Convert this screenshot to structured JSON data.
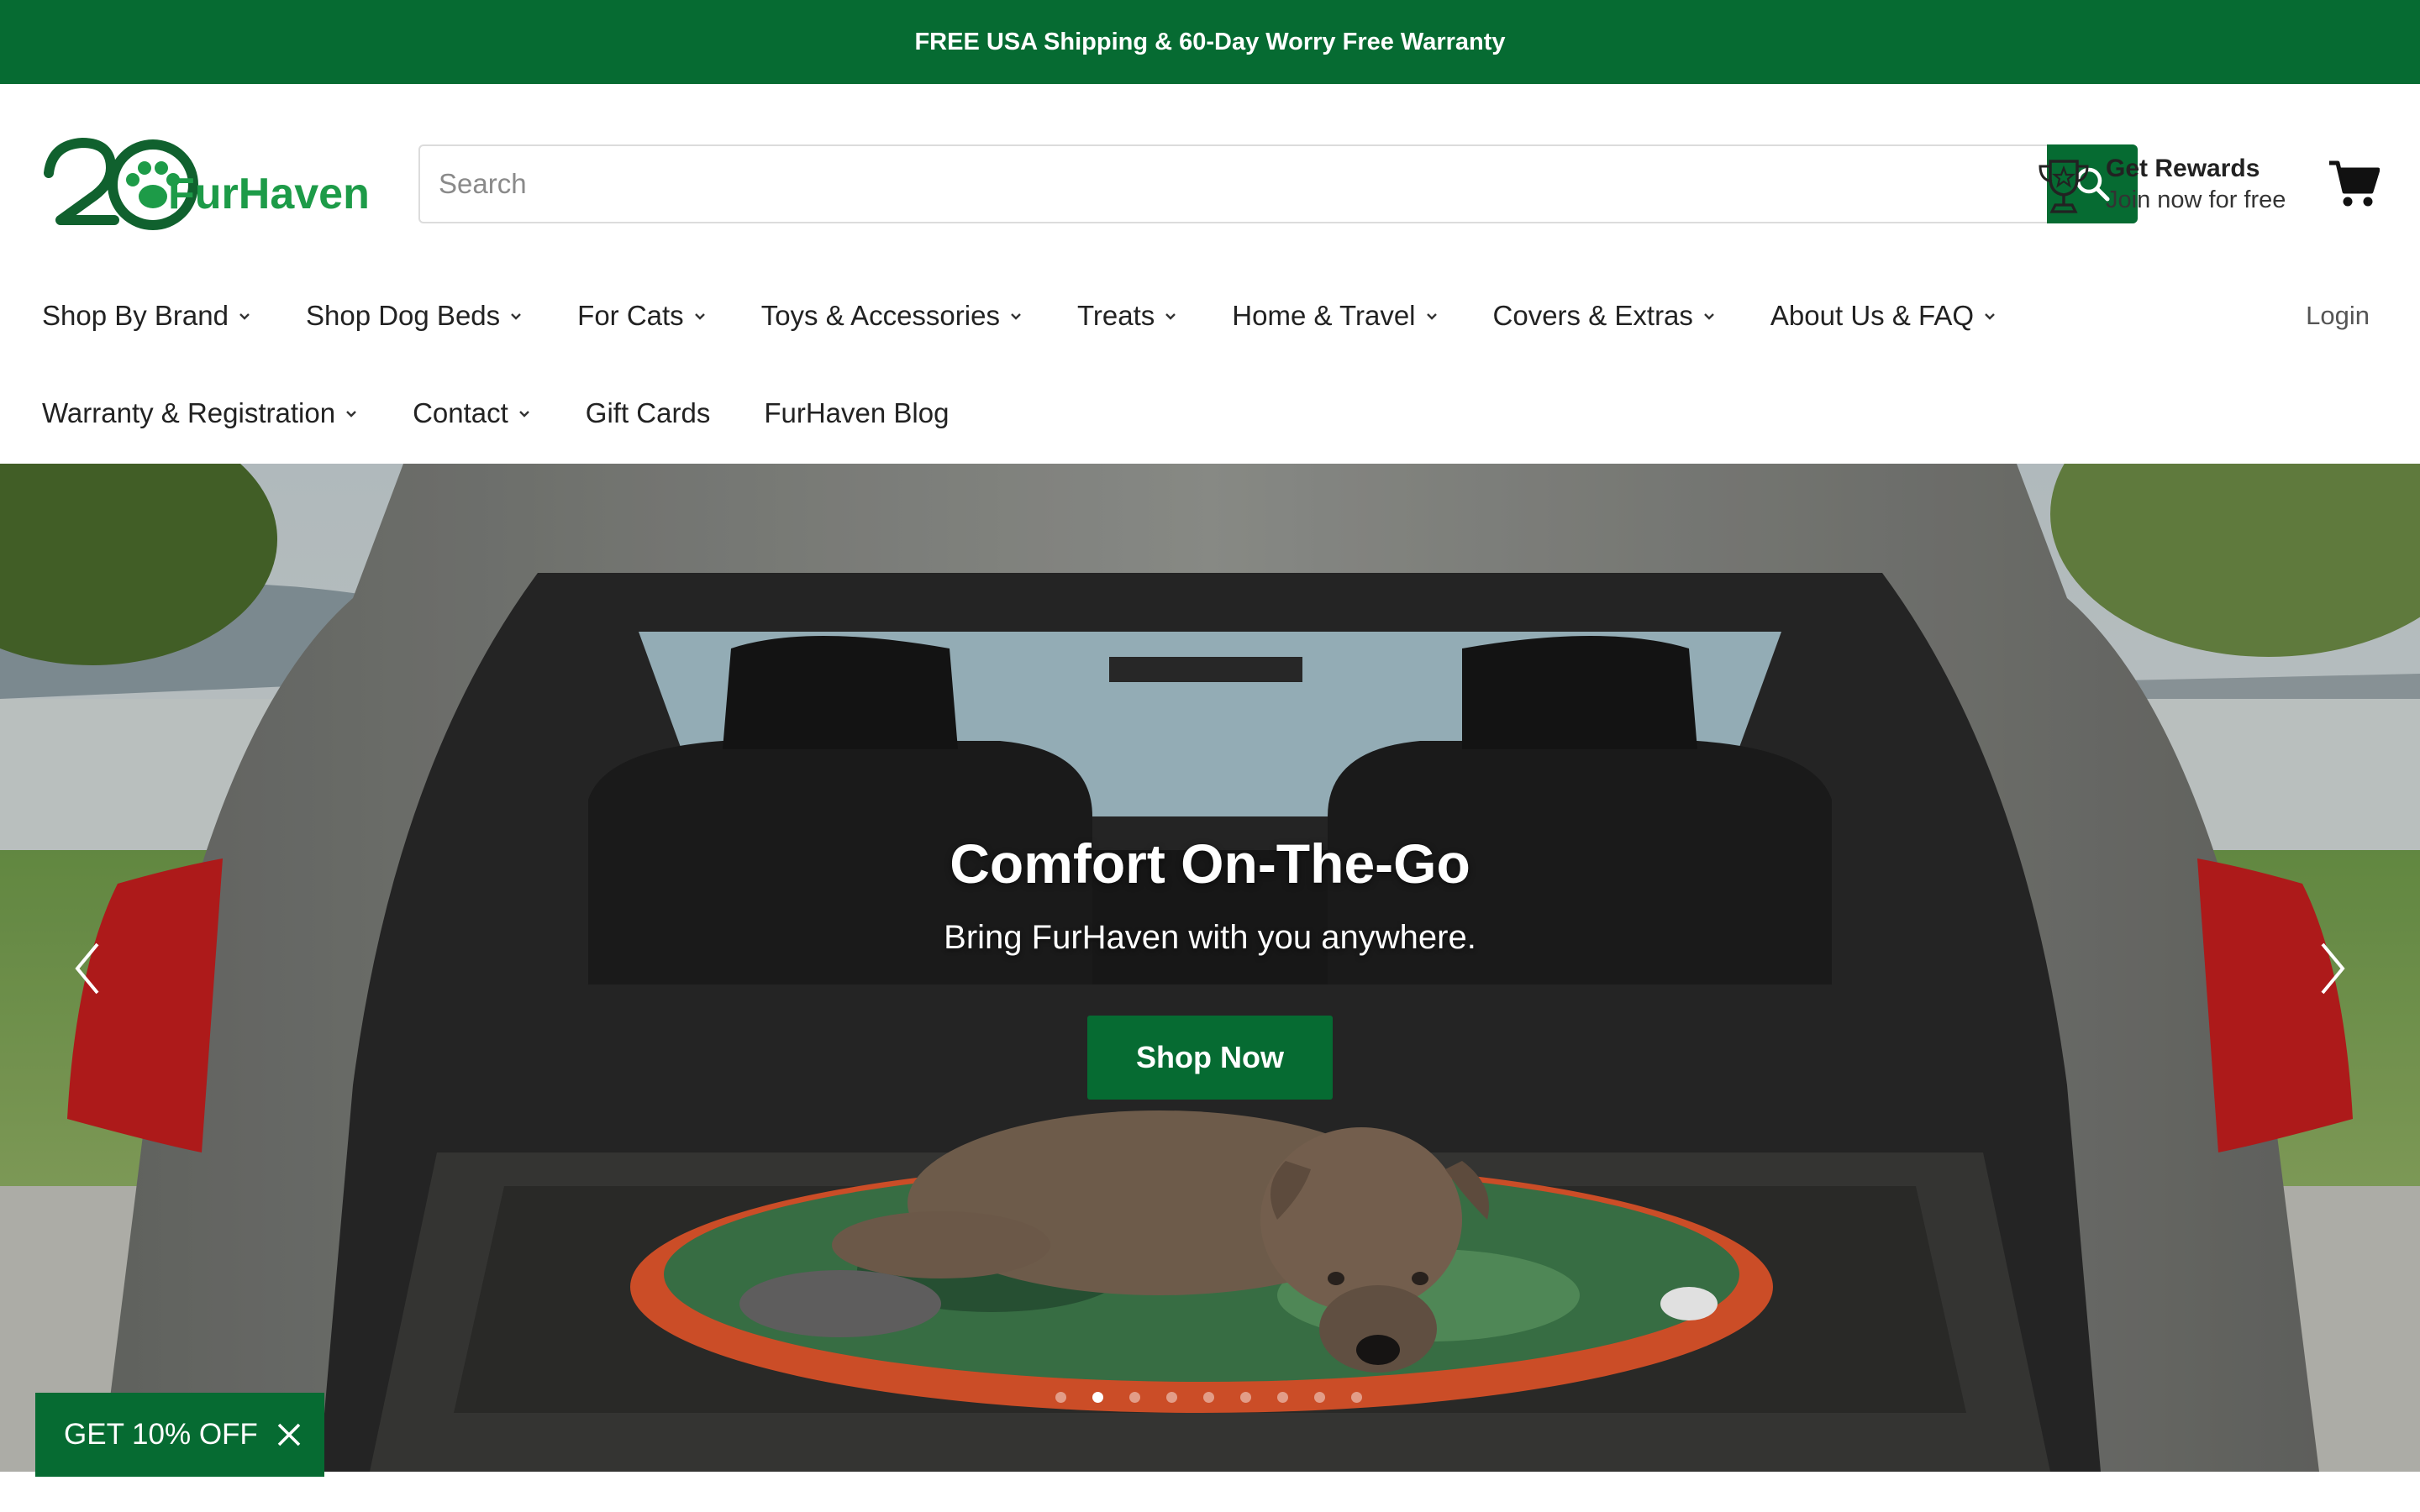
{
  "announcement": "FREE USA Shipping & 60-Day Worry Free Warranty",
  "brand": {
    "logo_text": "FurHaven",
    "logo_number": "20",
    "colors": {
      "primary": "#066b32",
      "logo_green": "#1d9b48",
      "logo_dark": "#10612e"
    }
  },
  "search": {
    "placeholder": "Search",
    "value": "",
    "button_icon": "search-icon"
  },
  "rewards": {
    "title": "Get Rewards",
    "subtitle": "Join now for free",
    "icon": "trophy-icon"
  },
  "cart": {
    "icon": "cart-icon"
  },
  "nav": {
    "row1": [
      "Shop By Brand",
      "Shop Dog Beds",
      "For Cats",
      "Toys & Accessories",
      "Treats",
      "Home & Travel",
      "Covers & Extras",
      "About Us & FAQ"
    ],
    "row2": [
      "Warranty & Registration",
      "Contact",
      "Gift Cards",
      "FurHaven Blog"
    ],
    "login": "Login"
  },
  "hero": {
    "title": "Comfort On-The-Go",
    "subtitle": "Bring FurHaven with you anywhere.",
    "cta": "Shop Now",
    "slide_count": 9,
    "active_slide": 2
  },
  "promo": {
    "label": "GET 10% OFF",
    "close_icon": "close-icon"
  }
}
